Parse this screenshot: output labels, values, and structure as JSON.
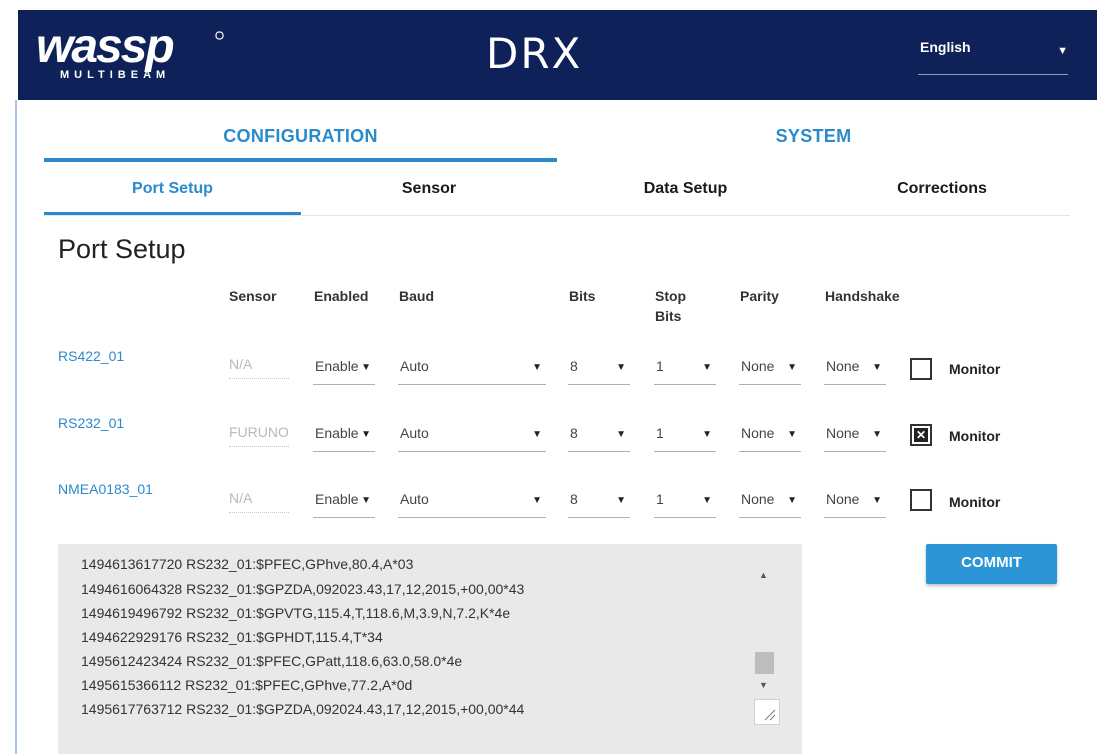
{
  "header": {
    "logo_text": "wassp",
    "logo_sub": "MULTIBEAM",
    "product": "DRX",
    "language": "English"
  },
  "main_tabs": [
    {
      "label": "CONFIGURATION",
      "active": true
    },
    {
      "label": "SYSTEM",
      "active": false
    }
  ],
  "sub_tabs": [
    {
      "label": "Port Setup",
      "active": true
    },
    {
      "label": "Sensor",
      "active": false
    },
    {
      "label": "Data Setup",
      "active": false
    },
    {
      "label": "Corrections",
      "active": false
    }
  ],
  "page_title": "Port Setup",
  "columns": {
    "sensor": "Sensor",
    "enabled": "Enabled",
    "baud": "Baud",
    "bits": "Bits",
    "stop_bits_1": "Stop",
    "stop_bits_2": "Bits",
    "parity": "Parity",
    "handshake": "Handshake"
  },
  "ports": [
    {
      "name": "RS422_01",
      "sensor": "N/A",
      "enabled": "Enable",
      "baud": "Auto",
      "bits": "8",
      "stop_bits": "1",
      "parity": "None",
      "handshake": "None",
      "monitor_checked": false,
      "monitor_label": "Monitor"
    },
    {
      "name": "RS232_01",
      "sensor": "FURUNO",
      "enabled": "Enable",
      "baud": "Auto",
      "bits": "8",
      "stop_bits": "1",
      "parity": "None",
      "handshake": "None",
      "monitor_checked": true,
      "monitor_label": "Monitor"
    },
    {
      "name": "NMEA0183_01",
      "sensor": "N/A",
      "enabled": "Enable",
      "baud": "Auto",
      "bits": "8",
      "stop_bits": "1",
      "parity": "None",
      "handshake": "None",
      "monitor_checked": false,
      "monitor_label": "Monitor"
    }
  ],
  "console_lines": [
    "1494613617720 RS232_01:$PFEC,GPhve,80.4,A*03",
    "1494616064328 RS232_01:$GPZDA,092023.43,17,12,2015,+00,00*43",
    "1494619496792 RS232_01:$GPVTG,115.4,T,118.6,M,3.9,N,7.2,K*4e",
    "1494622929176 RS232_01:$GPHDT,115.4,T*34",
    "1495612423424 RS232_01:$PFEC,GPatt,118.6,63.0,58.0*4e",
    "1495615366112 RS232_01:$PFEC,GPhve,77.2,A*0d",
    "1495617763712 RS232_01:$GPZDA,092024.43,17,12,2015,+00,00*44"
  ],
  "commit_label": "COMMIT",
  "colors": {
    "header_bg": "#0e2259",
    "accent": "#2a8bcc",
    "commit_bg": "#2b95d6"
  }
}
